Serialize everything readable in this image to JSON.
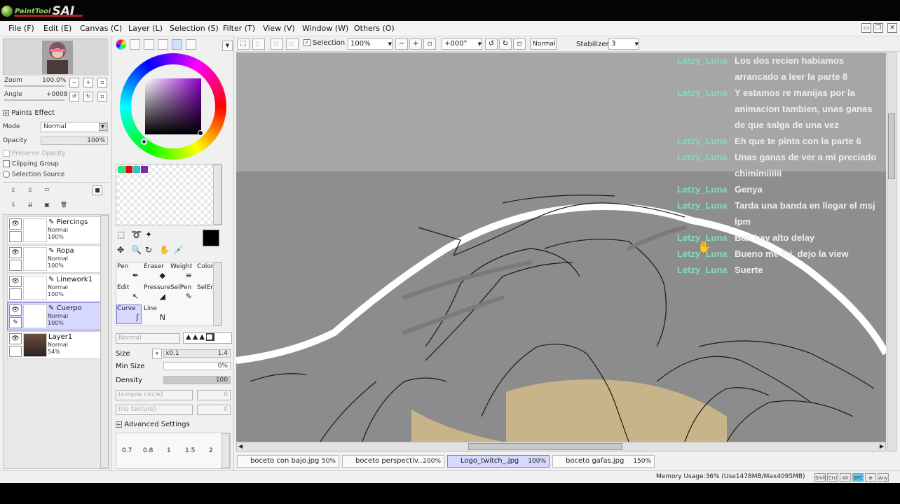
{
  "app": {
    "logo_small": "PaintTool",
    "logo_large": "SAI"
  },
  "menu": [
    "File (F)",
    "Edit (E)",
    "Canvas (C)",
    "Layer (L)",
    "Selection (S)",
    "Filter (T)",
    "View (V)",
    "Window (W)",
    "Others (O)"
  ],
  "navigator": {
    "zoom_label": "Zoom",
    "zoom_value": "100.0%",
    "angle_label": "Angle",
    "angle_value": "+0008"
  },
  "layer_panel": {
    "paints_effect": "Paints Effect",
    "mode_label": "Mode",
    "mode_value": "Normal",
    "opacity_label": "Opacity",
    "opacity_value": "100%",
    "preserve_opacity": "Preserve Opacity",
    "clipping_group": "Clipping Group",
    "selection_source": "Selection Source",
    "layers": [
      {
        "name": "Piercings",
        "mode": "Normal",
        "opacity": "100%"
      },
      {
        "name": "Ropa",
        "mode": "Normal",
        "opacity": "100%"
      },
      {
        "name": "Linework1",
        "mode": "Normal",
        "opacity": "100%"
      },
      {
        "name": "Cuerpo",
        "mode": "Normal",
        "opacity": "100%"
      },
      {
        "name": "Layer1",
        "mode": "Normal",
        "opacity": "54%"
      }
    ]
  },
  "tools": {
    "names": [
      "Pen",
      "Eraser",
      "Weight",
      "Color",
      "Edit",
      "Pressure",
      "SelPen",
      "SelEras",
      "Curve",
      "Line"
    ],
    "mode_value": "Normal",
    "size_label": "Size",
    "size_mult": "x0.1",
    "size_value": "1.4",
    "min_size_label": "Min Size",
    "min_size_value": "0%",
    "density_label": "Density",
    "density_value": "100",
    "simple_circle": "(simple circle)",
    "no_texture": "(no texture)",
    "advanced": "Advanced Settings",
    "presets": [
      "0.7",
      "0.8",
      "1",
      "1.5",
      "2"
    ]
  },
  "toolbar": {
    "selection_label": "Selection",
    "zoom_value": "100%",
    "angle_value": "+000°",
    "blend_value": "Normal",
    "stabilizer_label": "Stabilizer",
    "stabilizer_value": "3"
  },
  "chat": [
    {
      "user": "Letzy_Luna",
      "text": "Los dos recien habiamos arrancado a leer la parte 8"
    },
    {
      "user": "Letzy_Luna",
      "text": "Y estamos re manijas por la animacion tambien, unas ganas de que salga de una vez"
    },
    {
      "user": "Letzy_Luna",
      "text": "Eh que te pinta con la parte 6"
    },
    {
      "user": "Letzy_Luna",
      "text": "Unas ganas de ver a mi preciado chimimiiiiii"
    },
    {
      "user": "Letzy_Luna",
      "text": "Genya"
    },
    {
      "user": "Letzy_Luna",
      "text": "Tarda una banda en llegar el msj lpm"
    },
    {
      "user": "Letzy_Luna",
      "text": "Bah hay alto delay"
    },
    {
      "user": "Letzy_Luna",
      "text": "Bueno me fui, dejo la view"
    },
    {
      "user": "Letzy_Luna",
      "text": "Suerte"
    }
  ],
  "tabs": [
    {
      "name": "boceto con bajo.jpg",
      "zoom": "50%"
    },
    {
      "name": "boceto perspectiv...",
      "zoom": "100%"
    },
    {
      "name": "Logo_twitch_.jpg",
      "zoom": "100%"
    },
    {
      "name": "boceto gafas.jpg",
      "zoom": "150%"
    }
  ],
  "status": {
    "memory": "Memory Usage:36% (Use1478MB/Max4095MB)",
    "keys": [
      "Shift",
      "Ctrl",
      "Alt",
      "SPC",
      "",
      "Any"
    ]
  },
  "colors": {
    "accent": "#d6d8ff",
    "chat_user": "#7fe0b0",
    "canvas_bg": "#9a9a9a",
    "hair_bg": "#8c8c8c",
    "skin": "#c8b48a"
  }
}
